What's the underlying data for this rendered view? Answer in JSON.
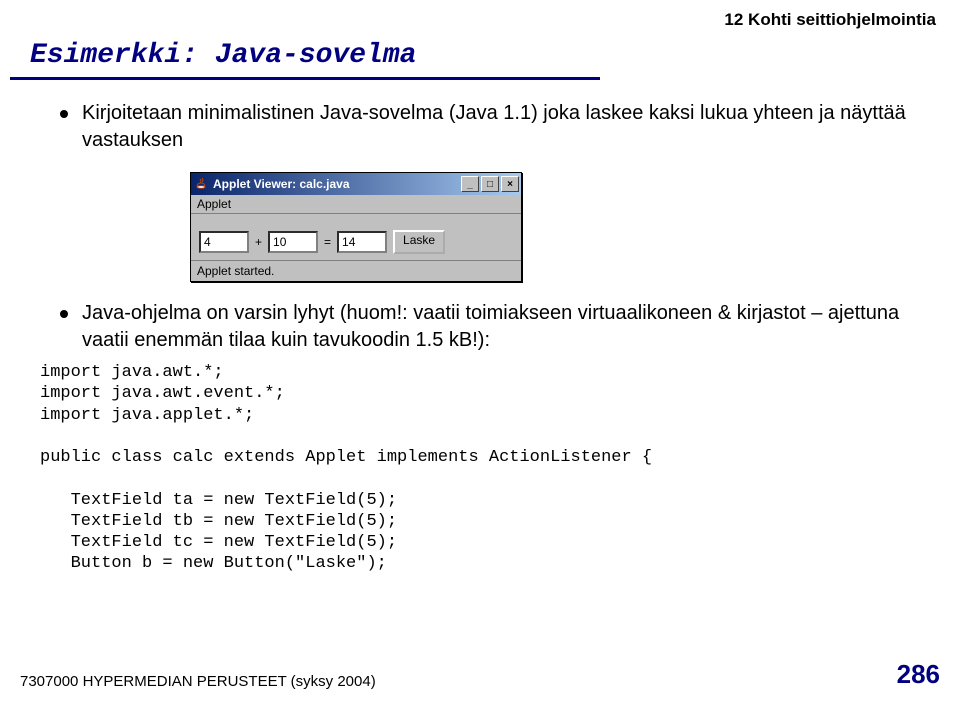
{
  "header": {
    "chapter": "12 Kohti seittiohjelmointia"
  },
  "title": "Esimerkki: Java-sovelma",
  "bullets": {
    "b1": "Kirjoitetaan minimalistinen Java-sovelma (Java 1.1) joka laskee kaksi lukua yhteen ja näyttää vastauksen",
    "b2": "Java-ohjelma on varsin lyhyt (huom!: vaatii toimiakseen virtuaalikoneen & kirjastot – ajettuna vaatii enemmän tilaa kuin tavukoodin 1.5 kB!):"
  },
  "applet": {
    "title": "Applet Viewer: calc.java",
    "menu": "Applet",
    "field_a": "4",
    "plus": "+",
    "field_b": "10",
    "eq": "=",
    "field_c": "14",
    "button": "Laske",
    "status": "Applet started.",
    "min": "_",
    "max": "□",
    "close": "×"
  },
  "code": {
    "l1": "import java.awt.*;",
    "l2": "import java.awt.event.*;",
    "l3": "import java.applet.*;",
    "l4": "public class calc extends Applet implements ActionListener {",
    "l5": "   TextField ta = new TextField(5);",
    "l6": "   TextField tb = new TextField(5);",
    "l7": "   TextField tc = new TextField(5);",
    "l8": "   Button b = new Button(\"Laske\");"
  },
  "footer": {
    "left": "7307000 HYPERMEDIAN PERUSTEET (syksy 2004)",
    "page": "286"
  }
}
